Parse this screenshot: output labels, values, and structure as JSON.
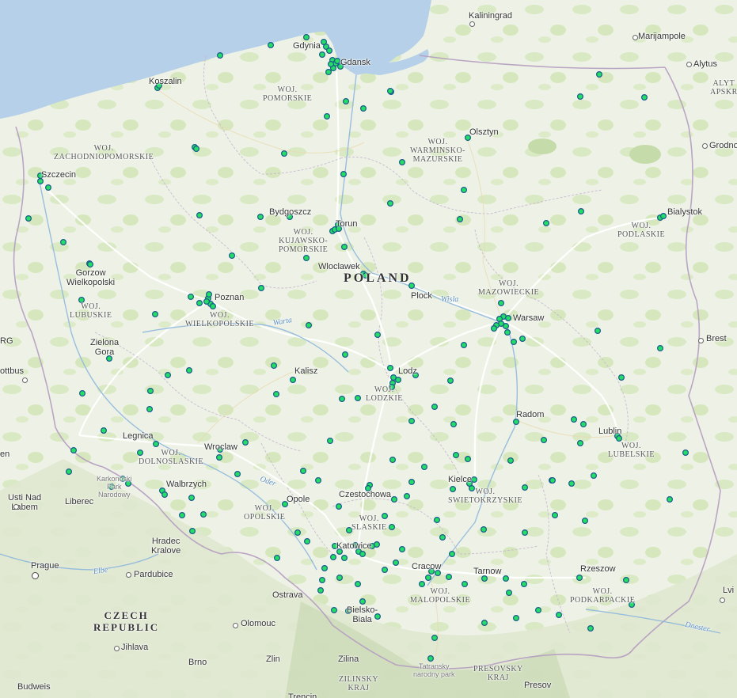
{
  "map": {
    "country": "POLAND",
    "countries": {
      "czech": "CZECH\nREPUBLIC"
    },
    "cities": [
      {
        "id": "kaliningrad",
        "name": "Kaliningrad"
      },
      {
        "id": "marijampole",
        "name": "Marijampole"
      },
      {
        "id": "alytus",
        "name": "Alytus"
      },
      {
        "id": "gdynia",
        "name": "Gdynia"
      },
      {
        "id": "gdansk",
        "name": "Gdansk"
      },
      {
        "id": "koszalin",
        "name": "Koszalin"
      },
      {
        "id": "grodno",
        "name": "Grodno"
      },
      {
        "id": "olsztyn",
        "name": "Olsztyn"
      },
      {
        "id": "szczecin",
        "name": "Szczecin"
      },
      {
        "id": "bydgoszcz",
        "name": "Bydgoszcz"
      },
      {
        "id": "torun",
        "name": "Torun"
      },
      {
        "id": "bialystok",
        "name": "Bialystok"
      },
      {
        "id": "gorzow",
        "name": "Gorzow\nWielkopolski"
      },
      {
        "id": "wloclawek",
        "name": "Wloclawek"
      },
      {
        "id": "plock",
        "name": "Plock"
      },
      {
        "id": "poznan",
        "name": "Poznan"
      },
      {
        "id": "warsaw",
        "name": "Warsaw"
      },
      {
        "id": "brest",
        "name": "Brest"
      },
      {
        "id": "zielona",
        "name": "Zielona\nGora"
      },
      {
        "id": "kalisz",
        "name": "Kalisz"
      },
      {
        "id": "cottbus",
        "name": "ottbus"
      },
      {
        "id": "lodz",
        "name": "Lodz"
      },
      {
        "id": "radom",
        "name": "Radom"
      },
      {
        "id": "lublin",
        "name": "Lublin"
      },
      {
        "id": "legnica",
        "name": "Legnica"
      },
      {
        "id": "wroclaw",
        "name": "Wroclaw"
      },
      {
        "id": "walbrzych",
        "name": "Walbrzych"
      },
      {
        "id": "opole",
        "name": "Opole"
      },
      {
        "id": "czestochowa",
        "name": "Czestochowa"
      },
      {
        "id": "kielce",
        "name": "Kielce"
      },
      {
        "id": "usti",
        "name": "Usti Nad\nLabem"
      },
      {
        "id": "liberec",
        "name": "Liberec"
      },
      {
        "id": "hradec",
        "name": "Hradec\nKralove"
      },
      {
        "id": "katowice",
        "name": "Katowice"
      },
      {
        "id": "prague",
        "name": "Prague"
      },
      {
        "id": "pardubice",
        "name": "Pardubice"
      },
      {
        "id": "cracow",
        "name": "Cracow"
      },
      {
        "id": "tarnow",
        "name": "Tarnow"
      },
      {
        "id": "rzeszow",
        "name": "Rzeszow"
      },
      {
        "id": "ostrava",
        "name": "Ostrava"
      },
      {
        "id": "bielsko",
        "name": "Bielsko-\nBiala"
      },
      {
        "id": "olomouc",
        "name": "Olomouc"
      },
      {
        "id": "jihlava",
        "name": "Jihlava"
      },
      {
        "id": "brno",
        "name": "Brno"
      },
      {
        "id": "zlin",
        "name": "Zlin"
      },
      {
        "id": "zilina",
        "name": "Zilina"
      },
      {
        "id": "presov",
        "name": "Presov"
      },
      {
        "id": "budweis",
        "name": "Budweis"
      },
      {
        "id": "trencin",
        "name": "Trencin"
      },
      {
        "id": "lviv",
        "name": "Lvi"
      },
      {
        "id": "en",
        "name": "en"
      },
      {
        "id": "rg",
        "name": "RG"
      }
    ],
    "regions": [
      {
        "id": "pomorskie",
        "name": "WOJ.\nPOMORSKIE"
      },
      {
        "id": "zachodniopomorskie",
        "name": "WOJ.\nZACHODNIOPOMORSKIE"
      },
      {
        "id": "warminsko",
        "name": "WOJ.\nWARMINSKO-\nMAZURSKIE"
      },
      {
        "id": "kujawsko",
        "name": "WOJ.\nKUJAWSKO-\nPOMORSKIE"
      },
      {
        "id": "podlaskie",
        "name": "WOJ.\nPODLASKIE"
      },
      {
        "id": "mazowieckie",
        "name": "WOJ.\nMAZOWIECKIE"
      },
      {
        "id": "lubuskie",
        "name": "WOJ.\nLUBUSKIE"
      },
      {
        "id": "wielkopolskie",
        "name": "WOJ.\nWIELKOPOLSKIE"
      },
      {
        "id": "lodzkie",
        "name": "WOJ.\nLODZKIE"
      },
      {
        "id": "lubelskie",
        "name": "WOJ.\nLUBELSKIE"
      },
      {
        "id": "dolnoslaskie",
        "name": "WOJ.\nDOLNOSLASKIE"
      },
      {
        "id": "swietokrzyskie",
        "name": "WOJ.\nSWIETOKRZYSKIE"
      },
      {
        "id": "opolskie",
        "name": "WOJ.\nOPOLSKIE"
      },
      {
        "id": "slaskie",
        "name": "WOJ.\nSLASKIE"
      },
      {
        "id": "malopolskie",
        "name": "WOJ.\nMALOPOLSKIE"
      },
      {
        "id": "podkarpackie",
        "name": "WOJ.\nPODKARPACKIE"
      },
      {
        "id": "zilinsky",
        "name": "ZILINSKY\nKRAJ"
      },
      {
        "id": "presovsky",
        "name": "PRESOVSKY\nKRAJ"
      },
      {
        "id": "alyt",
        "name": "ALYT\nAPSKR"
      }
    ],
    "rivers": [
      {
        "id": "wisla",
        "name": "Wisla"
      },
      {
        "id": "warta",
        "name": "Warta"
      },
      {
        "id": "oder",
        "name": "Oder"
      },
      {
        "id": "elbe",
        "name": "Elbe"
      },
      {
        "id": "dniester",
        "name": "Dnester"
      }
    ],
    "parks": [
      {
        "id": "karkonoski",
        "name": "Karkonoski\nPark\nNarodowy"
      },
      {
        "id": "tatransky",
        "name": "Tatransky\nnarodny park"
      }
    ],
    "colors": {
      "water": "#b5d0e8",
      "land": "#eef2e6",
      "forest": "#cfe3b0",
      "marker_fill": "#22dd66",
      "marker_stroke": "#1a5a8a",
      "border": "#a08aa8",
      "road": "#ffffff"
    },
    "markers_count": 219
  }
}
